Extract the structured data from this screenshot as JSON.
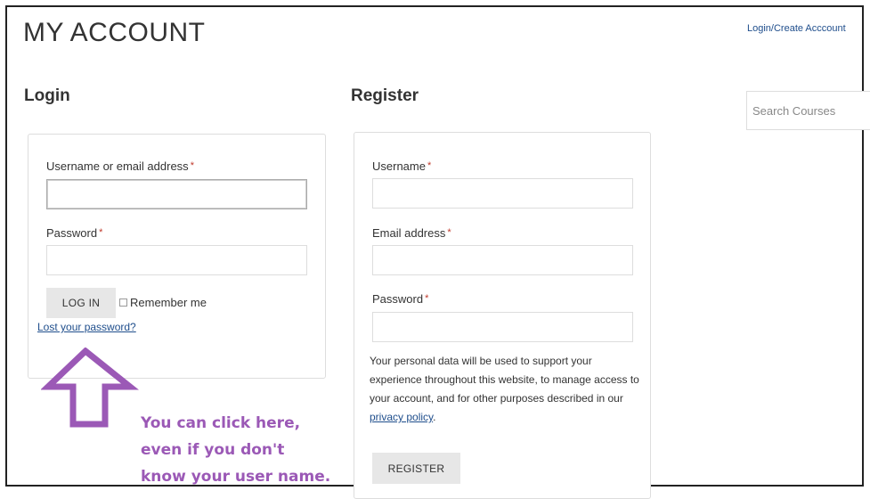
{
  "page": {
    "title": "MY ACCOUNT"
  },
  "top_nav": {
    "login_link": "Login/Create Acccount"
  },
  "search": {
    "placeholder": "Search Courses"
  },
  "login": {
    "heading": "Login",
    "username_label": "Username or email address",
    "password_label": "Password",
    "required_mark": "*",
    "submit_label": "LOG IN",
    "remember_label": "Remember me",
    "lost_password_link": "Lost your password?"
  },
  "register": {
    "heading": "Register",
    "username_label": "Username",
    "email_label": "Email address",
    "password_label": "Password",
    "required_mark": "*",
    "privacy_text": "Your personal data will be used to support your experience throughout this website, to manage access to your account, and for other purposes described in our",
    "privacy_link": "privacy policy",
    "privacy_suffix": ".",
    "submit_label": "REGISTER"
  },
  "annotation": {
    "text_lines": [
      "You can click here,",
      "even if you don't",
      "know your user name."
    ],
    "color": "#9b59b6",
    "icon": "up-arrow-icon"
  },
  "colors": {
    "link": "#1f4e8c",
    "required": "#c0392b",
    "button_bg": "#e7e7e7"
  }
}
